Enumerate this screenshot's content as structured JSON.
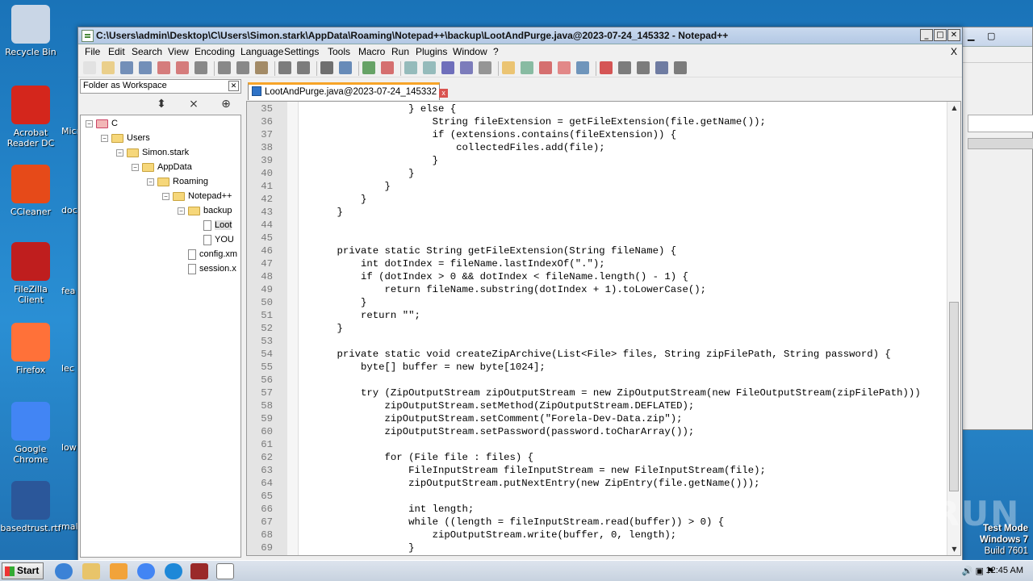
{
  "desktop": {
    "icons": [
      {
        "label": "Recycle Bin",
        "color": "#c9d6e6"
      },
      {
        "label": "Acrobat Reader DC",
        "color": "#d4261c"
      },
      {
        "label": "CCleaner",
        "color": "#e64a19"
      },
      {
        "label": "FileZilla Client",
        "color": "#bf1e1e"
      },
      {
        "label": "Firefox",
        "color": "#ff7139"
      },
      {
        "label": "Google Chrome",
        "color": "#4285f4"
      },
      {
        "label": "basedtrust.rtf",
        "color": "#2b579a"
      }
    ],
    "partial_labels": [
      "Micr",
      "doc",
      "fea",
      "lec",
      "low",
      "male"
    ]
  },
  "window": {
    "title": "C:\\Users\\admin\\Desktop\\C\\Users\\Simon.stark\\AppData\\Roaming\\Notepad++\\backup\\LootAndPurge.java@2023-07-24_145332 - Notepad++",
    "menu": [
      "File",
      "Edit",
      "Search",
      "View",
      "Encoding",
      "Language",
      "Settings",
      "Tools",
      "Macro",
      "Run",
      "Plugins",
      "Window",
      "?"
    ],
    "menu_close": "X"
  },
  "panel": {
    "title": "Folder as Workspace",
    "close": "✕",
    "tree": [
      {
        "label": "C",
        "kind": "drive",
        "level": 0,
        "expanded": true
      },
      {
        "label": "Users",
        "kind": "folder",
        "level": 1,
        "expanded": true
      },
      {
        "label": "Simon.stark",
        "kind": "folder",
        "level": 2,
        "expanded": true
      },
      {
        "label": "AppData",
        "kind": "folder",
        "level": 3,
        "expanded": true
      },
      {
        "label": "Roaming",
        "kind": "folder",
        "level": 4,
        "expanded": true
      },
      {
        "label": "Notepad++",
        "kind": "folder",
        "level": 5,
        "expanded": true
      },
      {
        "label": "backup",
        "kind": "folder",
        "level": 6,
        "expanded": true
      },
      {
        "label": "Loot",
        "kind": "file",
        "level": 7,
        "selected": true
      },
      {
        "label": "YOU",
        "kind": "file",
        "level": 7
      },
      {
        "label": "config.xm",
        "kind": "file",
        "level": 6
      },
      {
        "label": "session.x",
        "kind": "file",
        "level": 6
      }
    ]
  },
  "tab": {
    "label": "LootAndPurge.java@2023-07-24_145332",
    "close": "x"
  },
  "editor": {
    "lines": [
      {
        "n": "35",
        "code": "                } else {"
      },
      {
        "n": "36",
        "code": "                    String fileExtension = getFileExtension(file.getName());"
      },
      {
        "n": "37",
        "code": "                    if (extensions.contains(fileExtension)) {"
      },
      {
        "n": "38",
        "code": "                        collectedFiles.add(file);"
      },
      {
        "n": "39",
        "code": "                    }"
      },
      {
        "n": "40",
        "code": "                }"
      },
      {
        "n": "41",
        "code": "            }"
      },
      {
        "n": "42",
        "code": "        }"
      },
      {
        "n": "43",
        "code": "    }"
      },
      {
        "n": "44",
        "code": ""
      },
      {
        "n": "45",
        "code": ""
      },
      {
        "n": "46",
        "code": "    private static String getFileExtension(String fileName) {"
      },
      {
        "n": "47",
        "code": "        int dotIndex = fileName.lastIndexOf(\".\");"
      },
      {
        "n": "48",
        "code": "        if (dotIndex > 0 && dotIndex < fileName.length() - 1) {"
      },
      {
        "n": "49",
        "code": "            return fileName.substring(dotIndex + 1).toLowerCase();"
      },
      {
        "n": "50",
        "code": "        }"
      },
      {
        "n": "51",
        "code": "        return \"\";"
      },
      {
        "n": "52",
        "code": "    }"
      },
      {
        "n": "53",
        "code": ""
      },
      {
        "n": "54",
        "code": "    private static void createZipArchive(List<File> files, String zipFilePath, String password) {"
      },
      {
        "n": "55",
        "code": "        byte[] buffer = new byte[1024];"
      },
      {
        "n": "56",
        "code": ""
      },
      {
        "n": "57",
        "code": "        try (ZipOutputStream zipOutputStream = new ZipOutputStream(new FileOutputStream(zipFilePath)))"
      },
      {
        "n": "58",
        "code": "            zipOutputStream.setMethod(ZipOutputStream.DEFLATED);"
      },
      {
        "n": "59",
        "code": "            zipOutputStream.setComment(\"Forela-Dev-Data.zip\");"
      },
      {
        "n": "60",
        "code": "            zipOutputStream.setPassword(password.toCharArray());"
      },
      {
        "n": "61",
        "code": ""
      },
      {
        "n": "62",
        "code": "            for (File file : files) {"
      },
      {
        "n": "63",
        "code": "                FileInputStream fileInputStream = new FileInputStream(file);"
      },
      {
        "n": "64",
        "code": "                zipOutputStream.putNextEntry(new ZipEntry(file.getName()));"
      },
      {
        "n": "65",
        "code": ""
      },
      {
        "n": "66",
        "code": "                int length;"
      },
      {
        "n": "67",
        "code": "                while ((length = fileInputStream.read(buffer)) > 0) {"
      },
      {
        "n": "68",
        "code": "                    zipOutputStream.write(buffer, 0, length);"
      },
      {
        "n": "69",
        "code": "                }"
      }
    ]
  },
  "watermark": "ANY RUN",
  "test_mode": {
    "line1": "Test Mode",
    "line2": "Windows 7",
    "line3": "Build 7601"
  },
  "taskbar": {
    "start": "Start",
    "clock": "12:45 AM"
  },
  "colors": {
    "tab_accent": "#f7a428",
    "title_bar": "#b3c8e4",
    "desktop": "#1f7bc0"
  }
}
